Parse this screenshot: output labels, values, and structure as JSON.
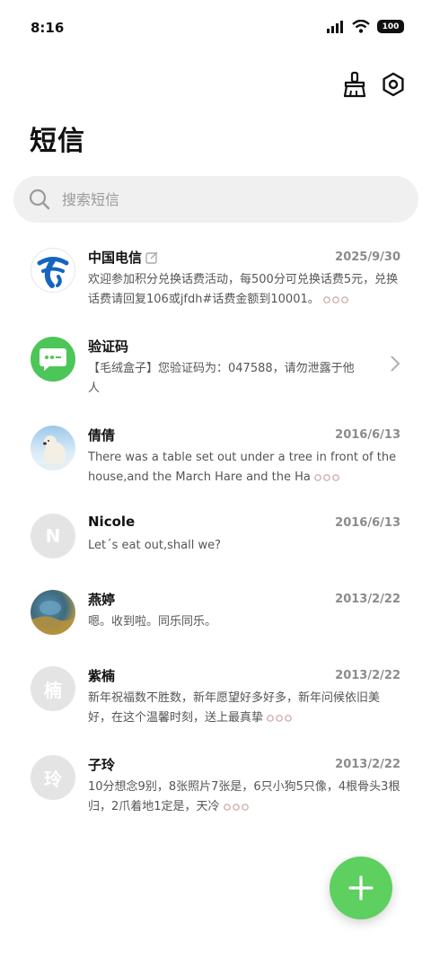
{
  "status_bar": {
    "time": "8:16",
    "battery": "100"
  },
  "page": {
    "title": "短信"
  },
  "search": {
    "placeholder": "搜索短信"
  },
  "colors": {
    "accent": "#5dd05f",
    "telecom_blue": "#1565c0",
    "date_gray": "#8c8c8c"
  },
  "messages": [
    {
      "name": "中国电信",
      "date": "2025/9/30",
      "preview": "欢迎参加积分兑换话费活动，每500分可兑换话费5元，兑换话费请回复106或jfdh#话费金额到10001。",
      "avatar": "china-telecom-logo",
      "badge": "edit-icon"
    },
    {
      "name": "验证码",
      "date": "",
      "preview": "【毛绒盒子】您验证码为：047588，请勿泄露于他人",
      "avatar": "chat-bubble-icon"
    },
    {
      "name": "倩倩",
      "date": "2016/6/13",
      "preview": "There was a table set out under a tree in front of the house,and the March Hare and the Ha",
      "avatar": "polar-bear-photo"
    },
    {
      "name": "Nicole",
      "date": "2016/6/13",
      "preview": "Let´s eat out,shall we?",
      "avatar_letter": "N"
    },
    {
      "name": "燕婷",
      "date": "2013/2/22",
      "preview": "嗯。收到啦。同乐同乐。",
      "avatar": "landscape-photo"
    },
    {
      "name": "紫楠",
      "date": "2013/2/22",
      "preview": "新年祝福数不胜数，新年愿望好多好多，新年问候依旧美好，在这个温馨时刻，送上最真挚",
      "avatar_letter": "楠"
    },
    {
      "name": "子玲",
      "date": "2013/2/22",
      "preview": "10分想念9别，8张照片7张是，6只小狗5只像，4根骨头3根归，2爪着地1定是，天冷",
      "avatar_letter": "玲"
    }
  ]
}
